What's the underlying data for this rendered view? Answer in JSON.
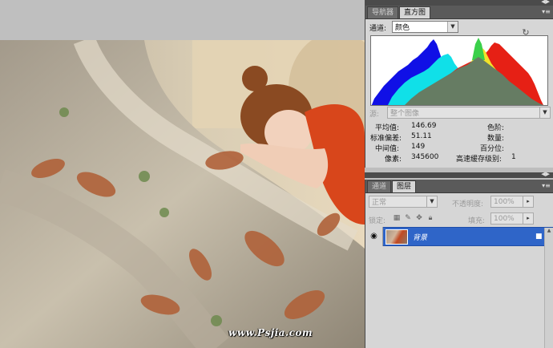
{
  "watermark": "www.Psjia.com",
  "histogram_panel": {
    "tabs": [
      "导航器",
      "直方图"
    ],
    "active_tab": 1,
    "channel_label": "通道:",
    "channel_value": "颜色",
    "source_label": "源:",
    "source_value": "整个图像",
    "stats": {
      "mean_label": "平均值:",
      "mean": "146.69",
      "stddev_label": "标准偏差:",
      "stddev": "51.11",
      "median_label": "中间值:",
      "median": "149",
      "pixels_label": "像素:",
      "pixels": "345600",
      "level_label": "色阶:",
      "level": "",
      "count_label": "数量:",
      "count": "",
      "percentile_label": "百分位:",
      "percentile": "",
      "cache_label": "高速缓存级别:",
      "cache": "1"
    },
    "colors": {
      "blue": "#1010e6",
      "cyan": "#10e0e8",
      "yellow": "#f2e22a",
      "red": "#e62015",
      "green": "#3aa040",
      "gray": "#667c63"
    }
  },
  "layers_panel": {
    "tabs": [
      "通道",
      "图层"
    ],
    "active_tab": 1,
    "blend_mode": "正常",
    "opacity_label": "不透明度:",
    "opacity_value": "100%",
    "lock_label": "锁定:",
    "fill_label": "填充:",
    "fill_value": "100%",
    "layer": {
      "name": "背景",
      "visible": true,
      "locked": true,
      "selected": true
    }
  }
}
